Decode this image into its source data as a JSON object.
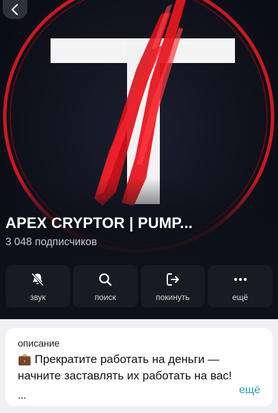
{
  "header": {
    "back_icon": "chevron-left-icon",
    "logo_letter": "T"
  },
  "channel": {
    "title": "APEX CRYPTOR | PUMP...",
    "subscribers": "3 048 подписчиков"
  },
  "actions": [
    {
      "label": "звук",
      "icon": "bell-slash-icon"
    },
    {
      "label": "поиск",
      "icon": "search-icon"
    },
    {
      "label": "покинуть",
      "icon": "leave-icon"
    },
    {
      "label": "ещё",
      "icon": "more-dots-icon"
    }
  ],
  "description": {
    "label": "описание",
    "emoji": "💼",
    "text": "Прекратите работать на деньги — начните заставлять их работать на вас!",
    "ellipsis": "...",
    "more_label": "ещё"
  },
  "colors": {
    "hero_bg": "#0d0f18",
    "accent_red": "#e11a22",
    "link": "#2a9ab6",
    "card_bg": "#ffffff"
  }
}
